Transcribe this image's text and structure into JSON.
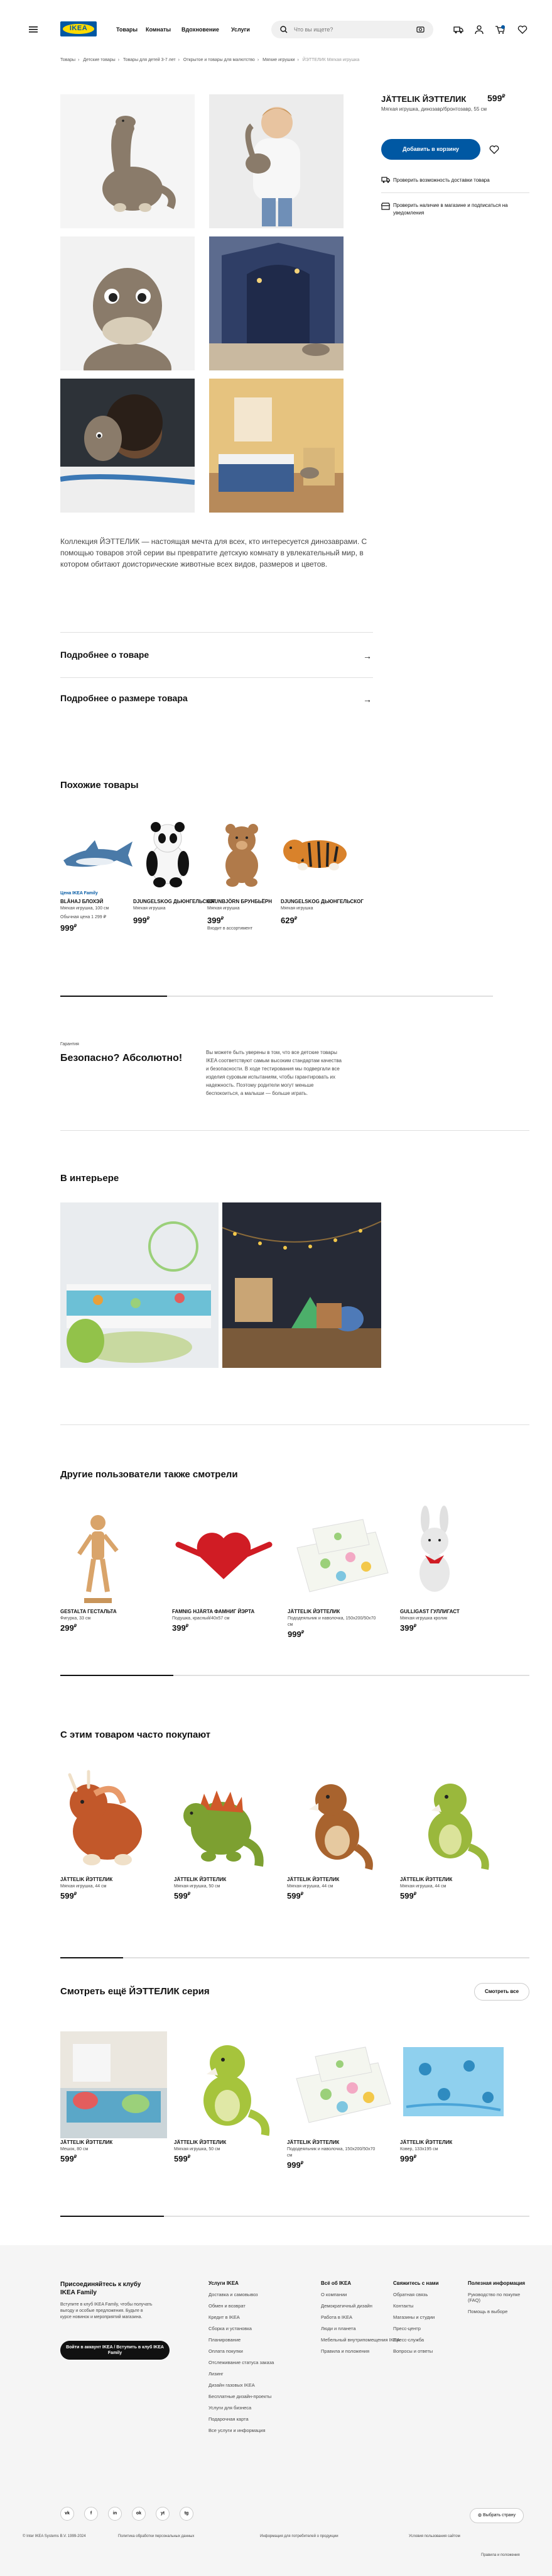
{
  "header": {
    "logo_text": "IKEA",
    "nav": [
      "Товары",
      "Комнаты",
      "Вдохновение",
      "Услуги"
    ],
    "search_placeholder": "Что вы ищете?"
  },
  "breadcrumb": [
    "Товары",
    "Детские товары",
    "Товары для детей 3-7 лет",
    "Открытое и товары для малютство",
    "Мягкие игрушки",
    "ЙЭТТЕЛИК Мягкая игрушка"
  ],
  "product": {
    "name": "JÄTTELIK ЙЭТТЕЛИК",
    "price_int": "599",
    "price_cur": "₽",
    "description": "Мягкая игрушка, динозавр/бронтозавр, 55 см",
    "add_to_cart": "Добавить в корзину",
    "check_delivery": "Проверить возможность доставки товара",
    "check_store": "Проверить наличие в магазине и подписаться на уведомления"
  },
  "collection_text": "Коллекция ЙЭТТЕЛИК — настоящая мечта для всех, кто интересуется динозаврами. С помощью товаров этой серии вы превратите детскую комнату в увлекательный мир, в котором обитают доисторические животные всех видов, размеров и цветов.",
  "accordions": [
    "Подробнее о товаре",
    "Подробнее о размере товара"
  ],
  "similar": {
    "title": "Похожие товары",
    "items": [
      {
        "family": "Цена IKEA Family",
        "name": "BLÅHAJ БЛОХЭЙ",
        "desc": "Мягкая игрушка, 100 см",
        "price": "999",
        "old": "Обычная цена 1 299 ₽",
        "note": ""
      },
      {
        "family": "",
        "name": "DJUNGELSKOG ДЬЮНГЕЛЬСКОГ",
        "desc": "Мягкая игрушка",
        "price": "999",
        "old": "",
        "note": ""
      },
      {
        "family": "",
        "name": "BRUNBJÖRN БРУНБЬЁРН",
        "desc": "Мягкая игрушка",
        "price": "399",
        "old": "",
        "note": "Входит в ассортимент"
      },
      {
        "family": "",
        "name": "DJUNGELSKOG ДЬЮНГЕЛЬСКОГ",
        "desc": "Мягкая игрушка",
        "price": "629",
        "old": "",
        "note": ""
      }
    ]
  },
  "secure": {
    "small": "Гарантия",
    "title": "Безопасно? Абсолютно!",
    "body": "Вы можете быть уверены в том, что все детские товары IKEA соответствуют самым высоким стандартам качества и безопасности. В ходе тестирования мы подвергали все изделия суровым испытаниям, чтобы гарантировать их надежность. Поэтому родители могут меньше беспокоиться, а малыши — больше играть."
  },
  "interior_title": "В интерьере",
  "others": {
    "title": "Другие пользователи также смотрели",
    "items": [
      {
        "name": "GESTALTA ГЕСТАЛЬТА",
        "desc": "Фигурка, 33 см",
        "price": "299"
      },
      {
        "name": "FAMNIG HJÄRTA ФАМНИГ ЙЭРТА",
        "desc": "Подушка, красный/40х57 см",
        "price": "399"
      },
      {
        "name": "JÄTTELIK ЙЭТТЕЛИК",
        "desc": "Пододеяльник и наволочка, 150х200/50х70 см",
        "price": "999"
      },
      {
        "name": "GULLIGAST ГУЛЛИГАСТ",
        "desc": "Мягкая игрушка кролик",
        "price": "399"
      }
    ]
  },
  "bought": {
    "title": "С этим товаром часто покупают",
    "items": [
      {
        "name": "JÄTTELIK ЙЭТТЕЛИК",
        "desc": "Мягкая игрушка, 44 см",
        "price": "599"
      },
      {
        "name": "JÄTTELIK ЙЭТТЕЛИК",
        "desc": "Мягкая игрушка, 50 см",
        "price": "599"
      },
      {
        "name": "JÄTTELIK ЙЭТТЕЛИК",
        "desc": "Мягкая игрушка, 44 см",
        "price": "599"
      },
      {
        "name": "JÄTTELIK ЙЭТТЕЛИК",
        "desc": "Мягкая игрушка, 44 см",
        "price": "599"
      }
    ]
  },
  "series": {
    "title": "Смотреть ещё ЙЭТТЕЛИК серия",
    "see_all": "Смотреть все",
    "items": [
      {
        "name": "JÄTTELIK ЙЭТТЕЛИК",
        "desc": "Мешок, 80 см",
        "price": "599"
      },
      {
        "name": "JÄTTELIK ЙЭТТЕЛИК",
        "desc": "Мягкая игрушка, 50 см",
        "price": "599"
      },
      {
        "name": "JÄTTELIK ЙЭТТЕЛИК",
        "desc": "Пододеяльник и наволочка, 150х200/50х70 см",
        "price": "999"
      },
      {
        "name": "JÄTTELIK ЙЭТТЕЛИК",
        "desc": "Ковер, 133х195 см",
        "price": "999"
      }
    ]
  },
  "footer": {
    "family_title": "Присоединяйтесь к клубу IKEA Family",
    "family_text": "Вступите в клуб IKEA Family, чтобы получать выгоду и особые предложения. Будьте в курсе новинок и мероприятий магазина.",
    "family_button": "Войти в аккаунт IKEA / Вступить в клуб IKEA Family",
    "columns": [
      {
        "title": "Услуги IKEA",
        "items": [
          "Доставка и самовывоз",
          "Обмен и возврат",
          "Кредит в IKEA",
          "Сборка и установка",
          "Планирование",
          "Оплата покупки",
          "Отслеживание статуса заказа",
          "Лизинг",
          "Дизайн газовых IKEA",
          "Бесплатные дизайн-проекты",
          "Услуги для бизнеса",
          "Подарочная карта",
          "Все услуги и информация"
        ]
      },
      {
        "title": "Всё об IKEA",
        "items": [
          "О компании",
          "Демократичный дизайн",
          "Работа в IKEA",
          "Люди и планета",
          "Мебельный внутрипомещения IKEA",
          "Правила и положения"
        ]
      },
      {
        "title": "Свяжитесь с нами",
        "items": [
          "Обратная связь",
          "Контакты",
          "Магазины и студии",
          "Пресс-центр",
          "Пресс-служба",
          "Вопросы и ответы"
        ]
      },
      {
        "title": "Полезная информация",
        "items": [
          "Руководство по покупке (FAQ)",
          "Помощь в выборе"
        ]
      }
    ],
    "social": [
      "vk",
      "f",
      "in",
      "ok",
      "yt",
      "tg"
    ],
    "country_button": "Выбрать страну",
    "legal": [
      "© Inter IKEA Systems B.V. 1999-2024",
      "Политика обработки персональных данных",
      "Информация для потребителей о продукции",
      "Условия пользования сайтом",
      "Правила и положения"
    ]
  },
  "colors": {
    "accent": "#0058a3",
    "logo_yellow": "#ffdb00",
    "footer_bg": "#f5f5f5"
  }
}
